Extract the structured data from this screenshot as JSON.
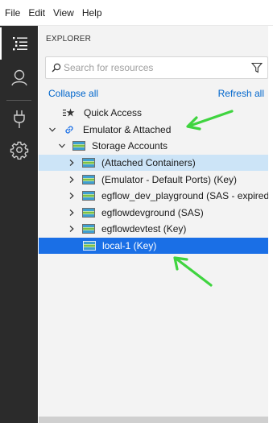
{
  "menu": [
    "File",
    "Edit",
    "View",
    "Help"
  ],
  "activity_bar": [
    {
      "icon": "explorer-icon",
      "active": true
    },
    {
      "icon": "account-icon",
      "active": false
    },
    {
      "icon": "plug-icon",
      "active": false
    },
    {
      "icon": "gear-icon",
      "active": false
    }
  ],
  "explorer": {
    "title": "EXPLORER",
    "search_placeholder": "Search for resources",
    "collapse_all": "Collapse all",
    "refresh_all": "Refresh all"
  },
  "tree": {
    "quick_access": "Quick Access",
    "emulator_attached": "Emulator & Attached",
    "storage_accounts": "Storage Accounts",
    "accounts": [
      "(Attached Containers)",
      "(Emulator - Default Ports) (Key)",
      "egflow_dev_playground (SAS - expired)",
      "egflowdevground (SAS)",
      "egflowdevtest (Key)",
      "local-1 (Key)"
    ]
  },
  "colors": {
    "accent": "#1a6fe6",
    "highlight": "#cce4f7",
    "link": "#0066cc",
    "arrow": "#3fd43f"
  }
}
